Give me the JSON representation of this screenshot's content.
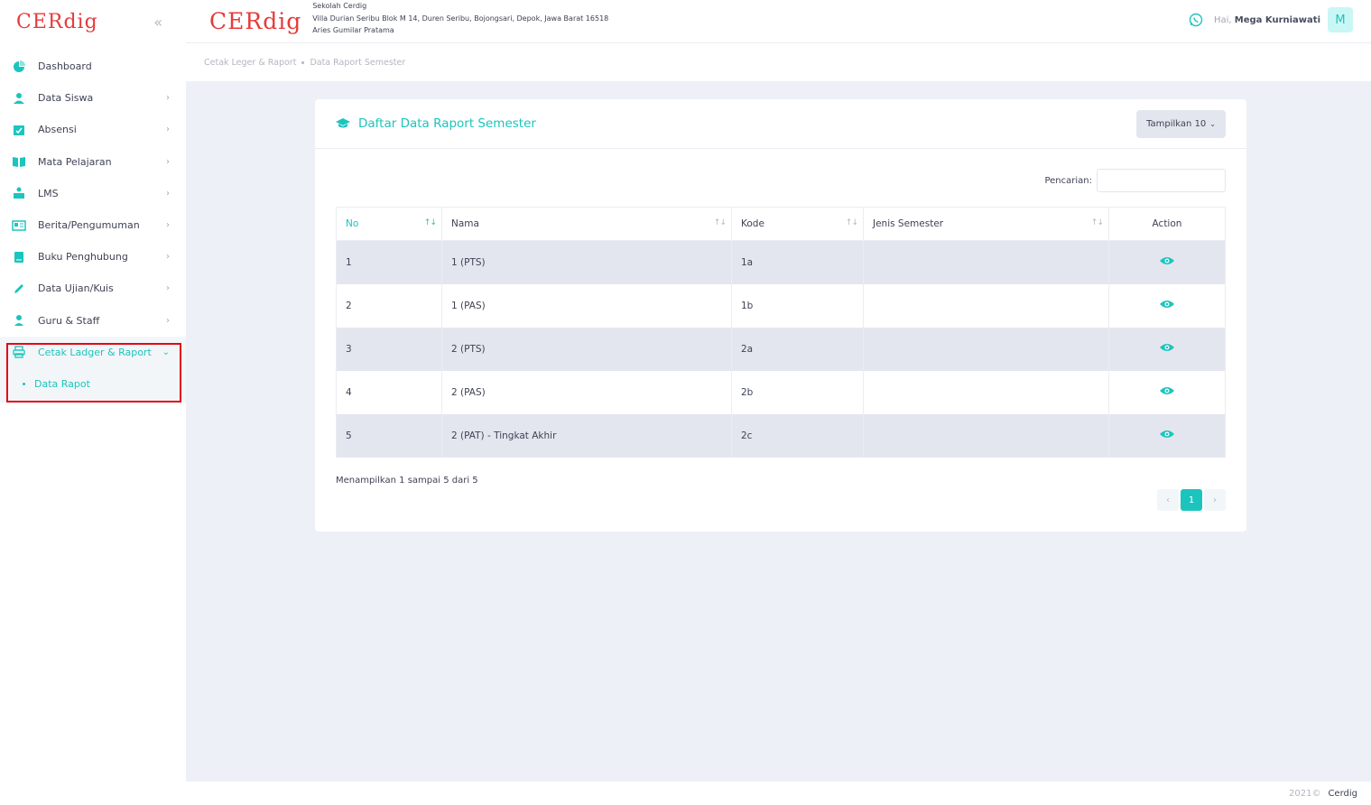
{
  "sidebar": {
    "logo": "CERdig",
    "items": [
      {
        "label": "Dashboard"
      },
      {
        "label": "Data Siswa"
      },
      {
        "label": "Absensi"
      },
      {
        "label": "Mata Pelajaran"
      },
      {
        "label": "LMS"
      },
      {
        "label": "Berita/Pengumuman"
      },
      {
        "label": "Buku Penghubung"
      },
      {
        "label": "Data Ujian/Kuis"
      },
      {
        "label": "Guru & Staff"
      },
      {
        "label": "Cetak Ladger & Raport"
      }
    ],
    "submenu": [
      {
        "label": "Data Rapot"
      }
    ]
  },
  "header": {
    "logo": "CERdig",
    "school_name": "Sekolah Cerdig",
    "address": "Villa Durian Seribu Blok M 14, Duren Seribu, Bojongsari, Depok, Jawa Barat 16518",
    "person": "Aries Gumilar Pratama",
    "greeting": "Hai,",
    "user_name": "Mega Kurniawati",
    "avatar_initial": "M"
  },
  "breadcrumb": {
    "items": [
      "Cetak Leger & Raport",
      "Data Raport Semester"
    ]
  },
  "card": {
    "title": "Daftar Data Raport Semester",
    "show_button": "Tampilkan 10",
    "search_label": "Pencarian:",
    "search_value": "",
    "columns": [
      "No",
      "Nama",
      "Kode",
      "Jenis Semester",
      "Action"
    ],
    "rows": [
      {
        "no": "1",
        "nama": "1 (PTS)",
        "kode": "1a",
        "jenis": ""
      },
      {
        "no": "2",
        "nama": "1 (PAS)",
        "kode": "1b",
        "jenis": ""
      },
      {
        "no": "3",
        "nama": "2 (PTS)",
        "kode": "2a",
        "jenis": ""
      },
      {
        "no": "4",
        "nama": "2 (PAS)",
        "kode": "2b",
        "jenis": ""
      },
      {
        "no": "5",
        "nama": "2 (PAT) - Tingkat Akhir",
        "kode": "2c",
        "jenis": ""
      }
    ],
    "info": "Menampilkan 1 sampai 5 dari 5",
    "pagination": {
      "prev": "‹",
      "current": "1",
      "next": "›"
    }
  },
  "footer": {
    "year": "2021©",
    "brand": "Cerdig"
  },
  "colors": {
    "accent": "#1bc5bd",
    "brand_red": "#e53b3b",
    "highlight": "#e30613"
  }
}
